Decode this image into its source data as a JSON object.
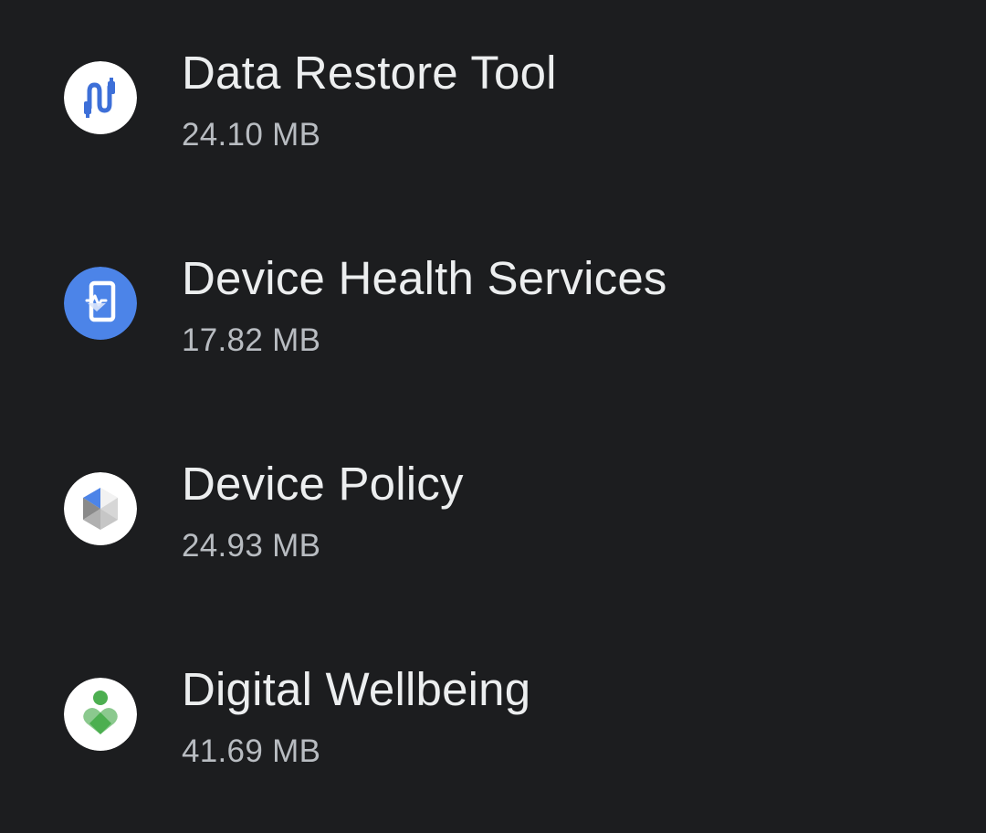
{
  "apps": [
    {
      "name": "Data Restore Tool",
      "size": "24.10 MB",
      "icon": "data-restore-icon",
      "icon_bg": "#ffffff",
      "icon_fg": "#3d6fd8"
    },
    {
      "name": "Device Health Services",
      "size": "17.82 MB",
      "icon": "device-health-icon",
      "icon_bg": "#4c84e8",
      "icon_fg": "#ffffff"
    },
    {
      "name": "Device Policy",
      "size": "24.93 MB",
      "icon": "device-policy-icon",
      "icon_bg": "#ffffff",
      "icon_fg": "#4c84e8"
    },
    {
      "name": "Digital Wellbeing",
      "size": "41.69 MB",
      "icon": "digital-wellbeing-icon",
      "icon_bg": "#ffffff",
      "icon_fg": "#4caf50"
    }
  ],
  "colors": {
    "background": "#1c1d1f",
    "title_text": "#eceeef",
    "subtitle_text": "#b8bcc1"
  }
}
